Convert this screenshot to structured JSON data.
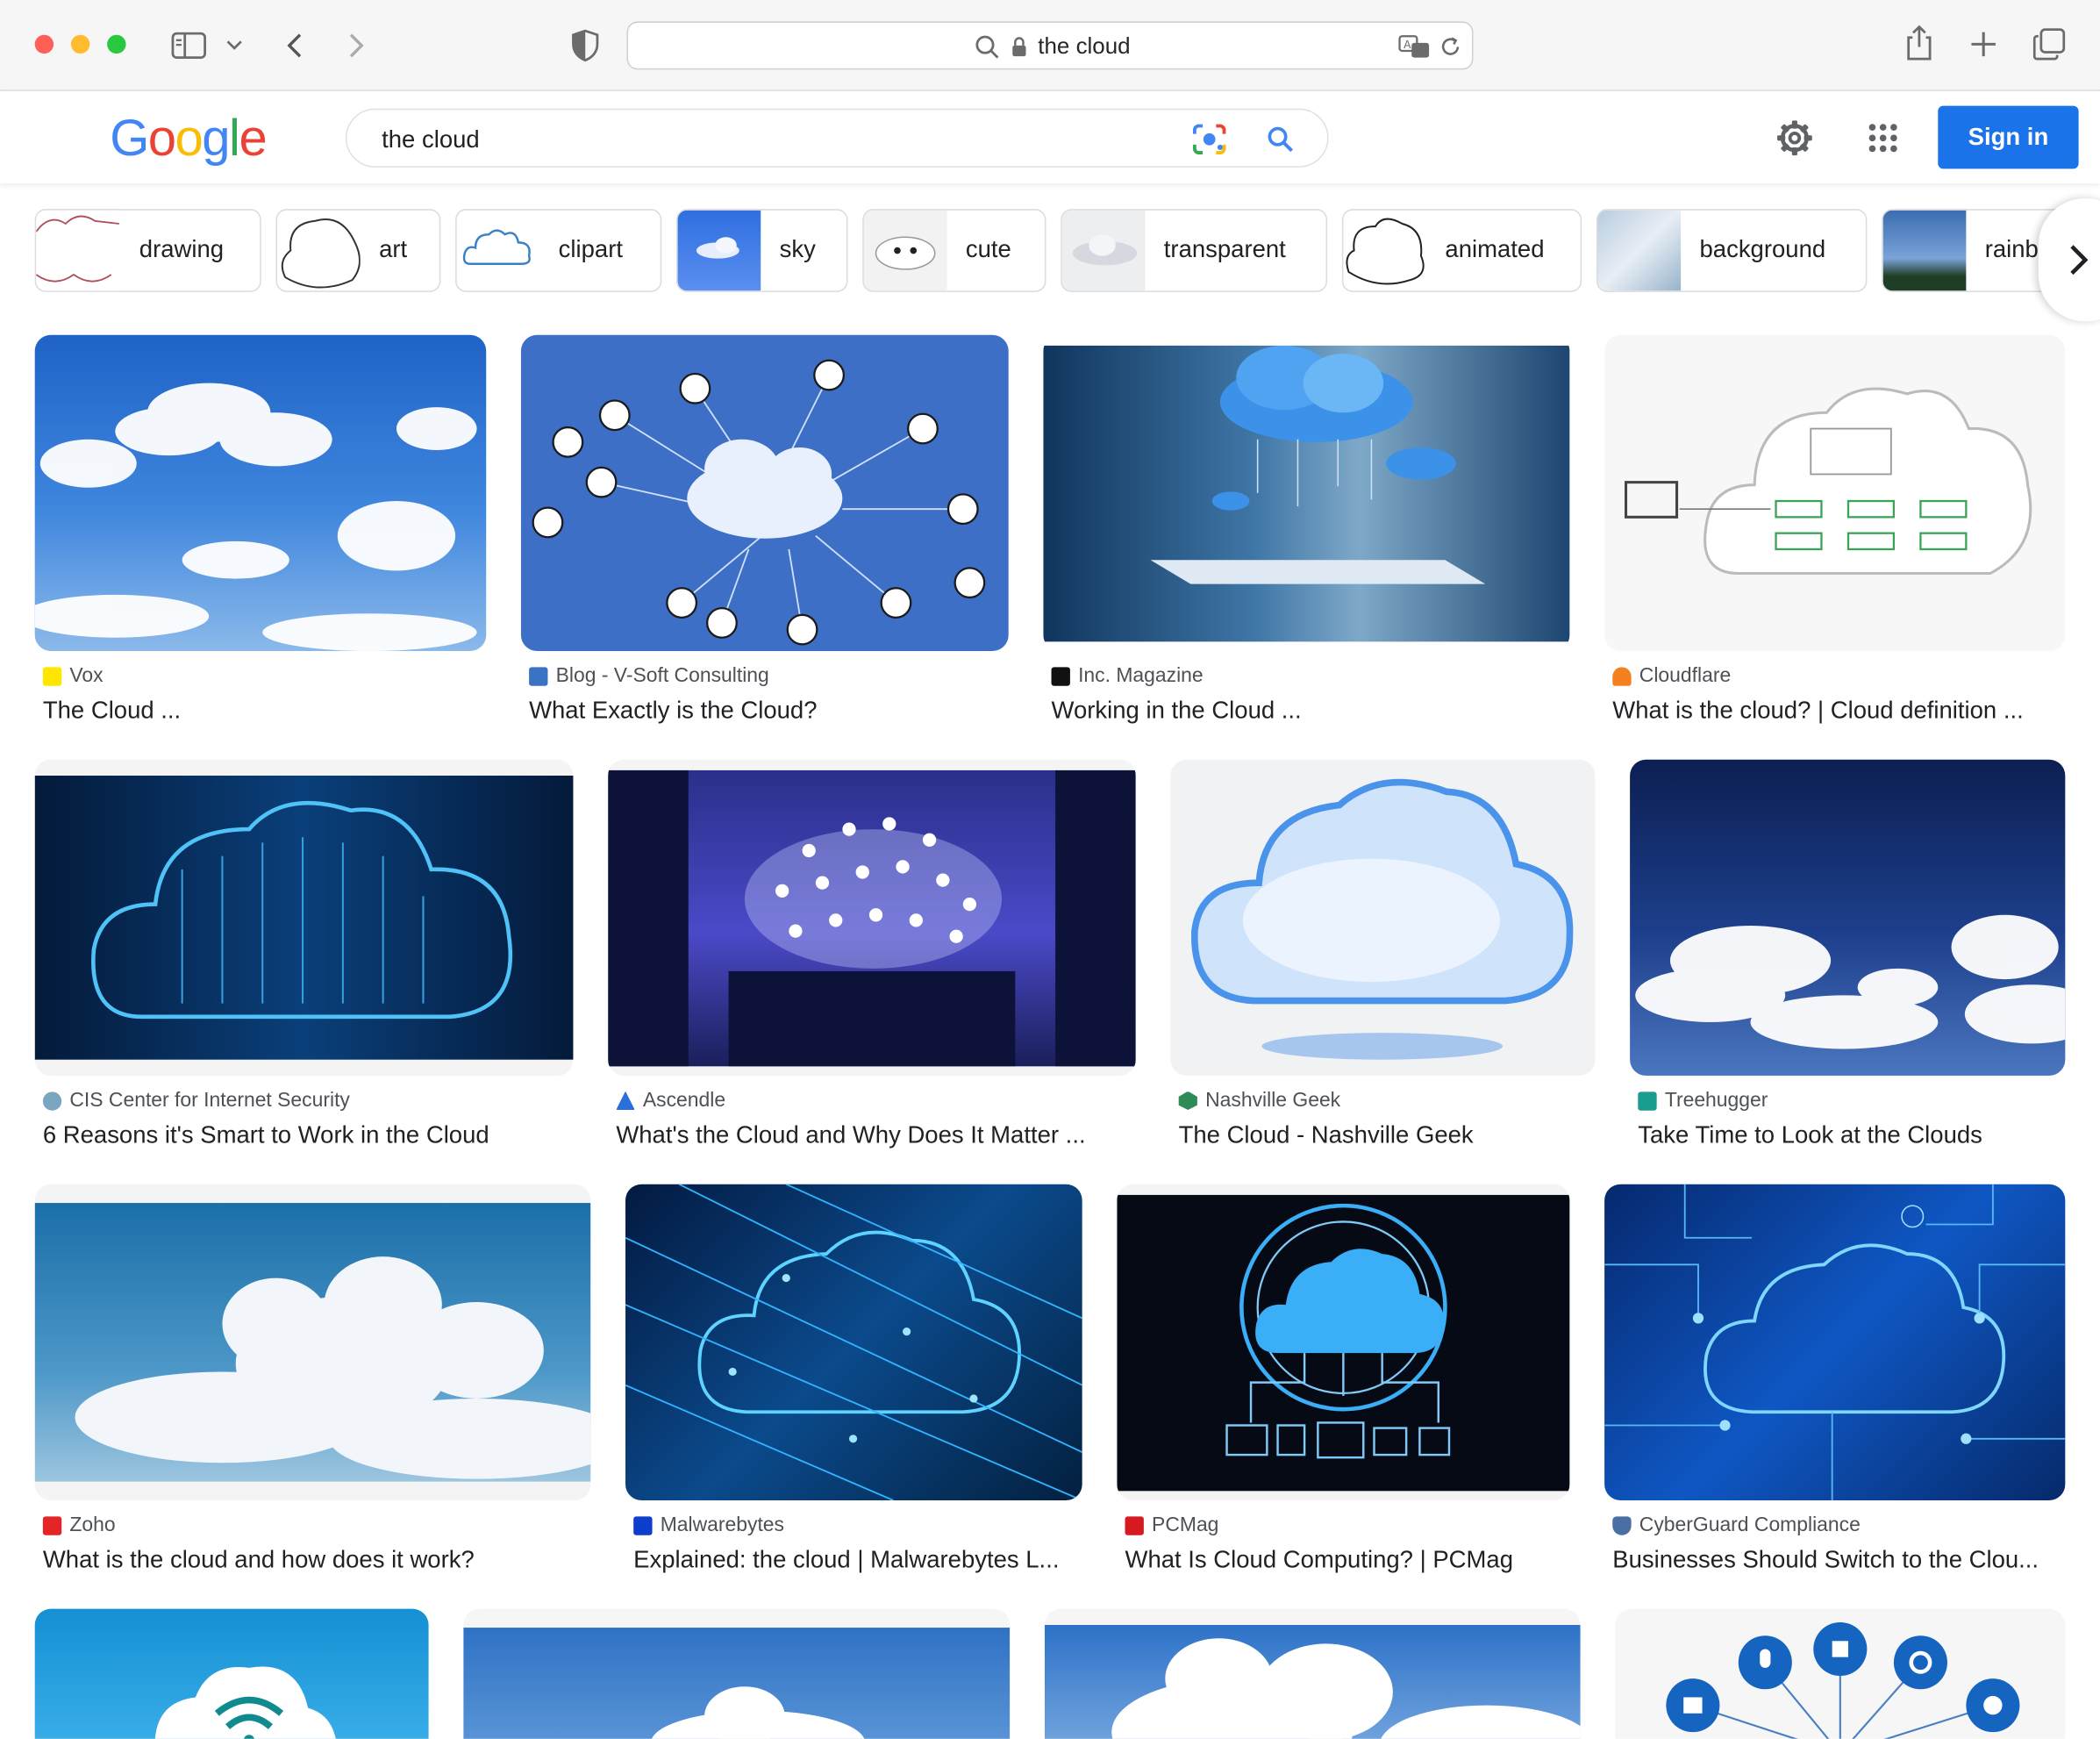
{
  "browser": {
    "url_text": "the cloud"
  },
  "google": {
    "logo": [
      "G",
      "o",
      "o",
      "g",
      "l",
      "e"
    ],
    "logo_colors": [
      "#4285F4",
      "#EA4335",
      "#FBBC05",
      "#4285F4",
      "#34A853",
      "#EA4335"
    ],
    "query": "the cloud",
    "sign_in_label": "Sign in"
  },
  "chips": [
    {
      "label": "drawing"
    },
    {
      "label": "art"
    },
    {
      "label": "clipart"
    },
    {
      "label": "sky"
    },
    {
      "label": "cute"
    },
    {
      "label": "transparent"
    },
    {
      "label": "animated"
    },
    {
      "label": "background"
    },
    {
      "label": "rainb"
    }
  ],
  "results": [
    {
      "source": "Vox",
      "title": "The Cloud ...",
      "fav_color": "#ffe600"
    },
    {
      "source": "Blog - V-Soft Consulting",
      "title": "What Exactly is the Cloud?",
      "fav_color": "#3b73c4"
    },
    {
      "source": "Inc. Magazine",
      "title": "Working in the Cloud ...",
      "fav_color": "#111111"
    },
    {
      "source": "Cloudflare",
      "title": "What is the cloud? | Cloud definition ...",
      "fav_color": "#f48120"
    },
    {
      "source": "CIS Center for Internet Security",
      "title": "6 Reasons it's Smart to Work in the Cloud",
      "fav_color": "#7aa6c2"
    },
    {
      "source": "Ascendle",
      "title": "What's the Cloud and Why Does It Matter ...",
      "fav_color": "#2a6fdb"
    },
    {
      "source": "Nashville Geek",
      "title": "The Cloud - Nashville Geek",
      "fav_color": "#2e8b57"
    },
    {
      "source": "Treehugger",
      "title": "Take Time to Look at the Clouds",
      "fav_color": "#1a9c8f"
    },
    {
      "source": "Zoho",
      "title": "What is the cloud and how does it work?",
      "fav_color": "#e42527"
    },
    {
      "source": "Malwarebytes",
      "title": "Explained: the cloud | Malwarebytes L...",
      "fav_color": "#0d3ecc"
    },
    {
      "source": "PCMag",
      "title": "What Is Cloud Computing? | PCMag",
      "fav_color": "#d71920"
    },
    {
      "source": "CyberGuard Compliance",
      "title": "Businesses Should Switch to the Clou...",
      "fav_color": "#4a6fa5"
    }
  ]
}
